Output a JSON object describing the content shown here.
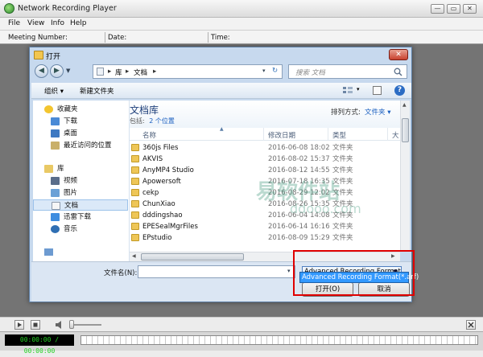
{
  "window": {
    "title": "Network Recording Player",
    "minimize": "—",
    "restore": "▭",
    "close": "✕"
  },
  "menu": [
    "File",
    "View",
    "Info",
    "Help"
  ],
  "infobar": {
    "meeting_number": "Meeting Number:",
    "date": "Date:",
    "time": "Time:"
  },
  "dialog": {
    "title": "打开",
    "breadcrumb": [
      "库",
      "文档"
    ],
    "search_placeholder": "搜索 文档",
    "toolbar": {
      "organize": "组织 ▾",
      "new_folder": "新建文件夹"
    },
    "nav": {
      "favorites": "收藏夹",
      "favorites_items": [
        "下载",
        "桌面",
        "最近访问的位置"
      ],
      "libraries": "库",
      "libraries_items": [
        "视频",
        "图片",
        "文档",
        "迅雷下载",
        "音乐"
      ]
    },
    "library": {
      "title": "文档库",
      "includes": "包括:",
      "locations": "2 个位置",
      "sort_label": "排列方式:",
      "sort_value": "文件夹 ▾"
    },
    "columns": {
      "name": "名称",
      "date": "修改日期",
      "type": "类型",
      "size": "大"
    },
    "files": [
      {
        "name": "360js Files",
        "date": "2016-06-08 18:02",
        "type": "文件夹"
      },
      {
        "name": "AKVIS",
        "date": "2016-08-02 15:37",
        "type": "文件夹"
      },
      {
        "name": "AnyMP4 Studio",
        "date": "2016-08-12 14:55",
        "type": "文件夹"
      },
      {
        "name": "Apowersoft",
        "date": "2016-07-18 16:35",
        "type": "文件夹"
      },
      {
        "name": "cekp",
        "date": "2016-08-29 12:02",
        "type": "文件夹"
      },
      {
        "name": "ChunXiao",
        "date": "2016-08-26 15:35",
        "type": "文件夹"
      },
      {
        "name": "dddingshao",
        "date": "2016-06-04 14:08",
        "type": "文件夹"
      },
      {
        "name": "EPESealMgrFiles",
        "date": "2016-06-14 16:16",
        "type": "文件夹"
      },
      {
        "name": "EPstudio",
        "date": "2016-08-09 15:29",
        "type": "文件夹"
      }
    ],
    "filename_label": "文件名(N):",
    "filename_value": "",
    "filetype_selected": "Advanced Recording Format",
    "filetype_option": "Advanced Recording Format(*.arf)",
    "open_button": "打开(O)",
    "cancel_button": "取消"
  },
  "player": {
    "time": "00:00:00 / 00:00:00"
  },
  "watermark": {
    "main": "易软件站",
    "sub": "ddooo.com"
  }
}
